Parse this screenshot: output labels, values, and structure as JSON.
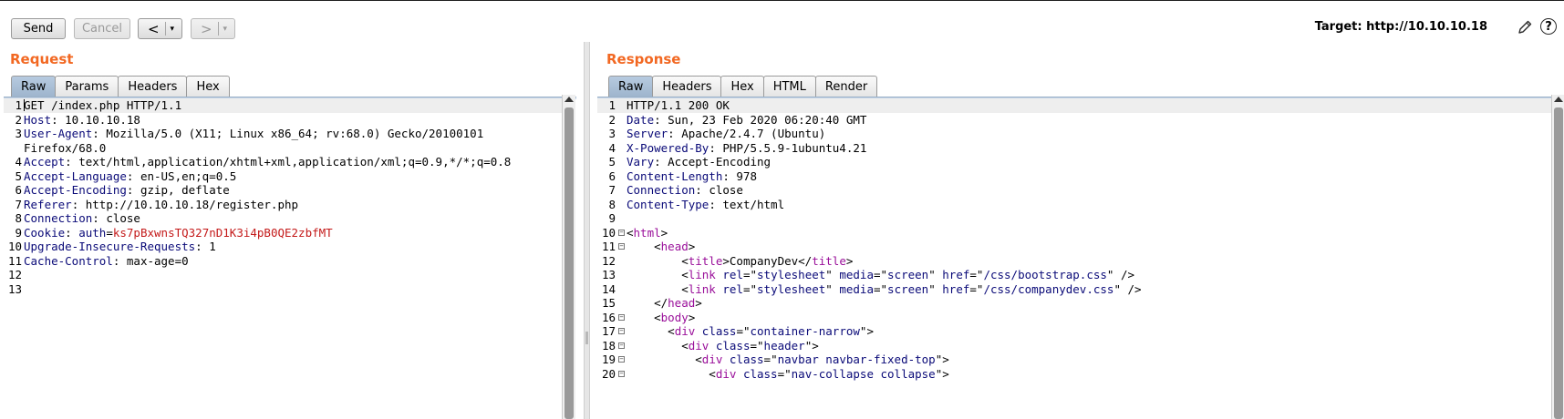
{
  "toolbar": {
    "send_label": "Send",
    "cancel_label": "Cancel",
    "back_glyph": "<",
    "forward_glyph": ">",
    "dropdown_glyph": "▾",
    "target_text": "Target: http://10.10.10.18",
    "help_glyph": "?",
    "icons": [
      "back-icon",
      "forward-icon",
      "pencil-icon",
      "help-icon"
    ]
  },
  "request": {
    "title": "Request",
    "tabs": [
      "Raw",
      "Params",
      "Headers",
      "Hex"
    ],
    "active_tab": "Raw",
    "lines": [
      {
        "n": "1",
        "parts": [
          [
            "",
            "GET /index.php HTTP/1.1"
          ]
        ]
      },
      {
        "n": "2",
        "parts": [
          [
            "hk",
            "Host"
          ],
          [
            "",
            ": 10.10.10.18"
          ]
        ]
      },
      {
        "n": "3",
        "parts": [
          [
            "hk",
            "User-Agent"
          ],
          [
            "",
            ": Mozilla/5.0 (X11; Linux x86_64; rv:68.0) Gecko/20100101"
          ]
        ]
      },
      {
        "n": "",
        "parts": [
          [
            "",
            "Firefox/68.0"
          ]
        ]
      },
      {
        "n": "4",
        "parts": [
          [
            "hk",
            "Accept"
          ],
          [
            "",
            ": text/html,application/xhtml+xml,application/xml;q=0.9,*/*;q=0.8"
          ]
        ]
      },
      {
        "n": "5",
        "parts": [
          [
            "hk",
            "Accept-Language"
          ],
          [
            "",
            ": en-US,en;q=0.5"
          ]
        ]
      },
      {
        "n": "6",
        "parts": [
          [
            "hk",
            "Accept-Encoding"
          ],
          [
            "",
            ": gzip, deflate"
          ]
        ]
      },
      {
        "n": "7",
        "parts": [
          [
            "hk",
            "Referer"
          ],
          [
            "",
            ": http://10.10.10.18/register.php"
          ]
        ]
      },
      {
        "n": "8",
        "parts": [
          [
            "hk",
            "Connection"
          ],
          [
            "",
            ": close"
          ]
        ]
      },
      {
        "n": "9",
        "parts": [
          [
            "hk",
            "Cookie"
          ],
          [
            "",
            ": "
          ],
          [
            "ck",
            "auth"
          ],
          [
            "",
            "="
          ],
          [
            "cv",
            "ks7pBxwnsTQ327nD1K3i4pB0QE2zbfMT"
          ]
        ]
      },
      {
        "n": "10",
        "parts": [
          [
            "hk",
            "Upgrade-Insecure-Requests"
          ],
          [
            "",
            ": 1"
          ]
        ]
      },
      {
        "n": "11",
        "parts": [
          [
            "hk",
            "Cache-Control"
          ],
          [
            "",
            ": max-age=0"
          ]
        ]
      },
      {
        "n": "12",
        "parts": []
      },
      {
        "n": "13",
        "parts": []
      }
    ]
  },
  "response": {
    "title": "Response",
    "tabs": [
      "Raw",
      "Headers",
      "Hex",
      "HTML",
      "Render"
    ],
    "active_tab": "Raw",
    "lines": [
      {
        "n": "1",
        "fold": false,
        "parts": [
          [
            "",
            "HTTP/1.1 200 OK"
          ]
        ]
      },
      {
        "n": "2",
        "fold": false,
        "parts": [
          [
            "hk",
            "Date"
          ],
          [
            "",
            ": Sun, 23 Feb 2020 06:20:40 GMT"
          ]
        ]
      },
      {
        "n": "3",
        "fold": false,
        "parts": [
          [
            "hk",
            "Server"
          ],
          [
            "",
            ": Apache/2.4.7 (Ubuntu)"
          ]
        ]
      },
      {
        "n": "4",
        "fold": false,
        "parts": [
          [
            "hk",
            "X-Powered-By"
          ],
          [
            "",
            ": PHP/5.5.9-1ubuntu4.21"
          ]
        ]
      },
      {
        "n": "5",
        "fold": false,
        "parts": [
          [
            "hk",
            "Vary"
          ],
          [
            "",
            ": Accept-Encoding"
          ]
        ]
      },
      {
        "n": "6",
        "fold": false,
        "parts": [
          [
            "hk",
            "Content-Length"
          ],
          [
            "",
            ": 978"
          ]
        ]
      },
      {
        "n": "7",
        "fold": false,
        "parts": [
          [
            "hk",
            "Connection"
          ],
          [
            "",
            ": close"
          ]
        ]
      },
      {
        "n": "8",
        "fold": false,
        "parts": [
          [
            "hk",
            "Content-Type"
          ],
          [
            "",
            ": text/html"
          ]
        ]
      },
      {
        "n": "9",
        "fold": false,
        "parts": []
      },
      {
        "n": "10",
        "fold": true,
        "parts": [
          [
            "",
            "<"
          ],
          [
            "tg",
            "html"
          ],
          [
            "",
            ">"
          ]
        ]
      },
      {
        "n": "11",
        "fold": true,
        "parts": [
          [
            "",
            "    <"
          ],
          [
            "tg",
            "head"
          ],
          [
            "",
            ">"
          ]
        ]
      },
      {
        "n": "12",
        "fold": false,
        "parts": [
          [
            "",
            "        <"
          ],
          [
            "tg",
            "title"
          ],
          [
            "",
            ">CompanyDev</"
          ],
          [
            "tg",
            "title"
          ],
          [
            "",
            ">"
          ]
        ]
      },
      {
        "n": "13",
        "fold": false,
        "parts": [
          [
            "",
            "        <"
          ],
          [
            "tg",
            "link"
          ],
          [
            "",
            " "
          ],
          [
            "at",
            "rel"
          ],
          [
            "",
            "=\""
          ],
          [
            "av",
            "stylesheet"
          ],
          [
            "",
            "\" "
          ],
          [
            "at",
            "media"
          ],
          [
            "",
            "=\""
          ],
          [
            "av",
            "screen"
          ],
          [
            "",
            "\" "
          ],
          [
            "at",
            "href"
          ],
          [
            "",
            "=\""
          ],
          [
            "av",
            "/css/bootstrap.css"
          ],
          [
            "",
            "\" />"
          ]
        ]
      },
      {
        "n": "14",
        "fold": false,
        "parts": [
          [
            "",
            "        <"
          ],
          [
            "tg",
            "link"
          ],
          [
            "",
            " "
          ],
          [
            "at",
            "rel"
          ],
          [
            "",
            "=\""
          ],
          [
            "av",
            "stylesheet"
          ],
          [
            "",
            "\" "
          ],
          [
            "at",
            "media"
          ],
          [
            "",
            "=\""
          ],
          [
            "av",
            "screen"
          ],
          [
            "",
            "\" "
          ],
          [
            "at",
            "href"
          ],
          [
            "",
            "=\""
          ],
          [
            "av",
            "/css/companydev.css"
          ],
          [
            "",
            "\" />"
          ]
        ]
      },
      {
        "n": "15",
        "fold": false,
        "parts": [
          [
            "",
            "    </"
          ],
          [
            "tg",
            "head"
          ],
          [
            "",
            ">"
          ]
        ]
      },
      {
        "n": "16",
        "fold": true,
        "parts": [
          [
            "",
            "    <"
          ],
          [
            "tg",
            "body"
          ],
          [
            "",
            ">"
          ]
        ]
      },
      {
        "n": "17",
        "fold": true,
        "parts": [
          [
            "",
            "      <"
          ],
          [
            "tg",
            "div"
          ],
          [
            "",
            " "
          ],
          [
            "at",
            "class"
          ],
          [
            "",
            "=\""
          ],
          [
            "av",
            "container-narrow"
          ],
          [
            "",
            "\">"
          ]
        ]
      },
      {
        "n": "18",
        "fold": true,
        "parts": [
          [
            "",
            "        <"
          ],
          [
            "tg",
            "div"
          ],
          [
            "",
            " "
          ],
          [
            "at",
            "class"
          ],
          [
            "",
            "=\""
          ],
          [
            "av",
            "header"
          ],
          [
            "",
            "\">"
          ]
        ]
      },
      {
        "n": "19",
        "fold": true,
        "parts": [
          [
            "",
            "          <"
          ],
          [
            "tg",
            "div"
          ],
          [
            "",
            " "
          ],
          [
            "at",
            "class"
          ],
          [
            "",
            "=\""
          ],
          [
            "av",
            "navbar navbar-fixed-top"
          ],
          [
            "",
            "\">"
          ]
        ]
      },
      {
        "n": "20",
        "fold": true,
        "parts": [
          [
            "",
            "            <"
          ],
          [
            "tg",
            "div"
          ],
          [
            "",
            " "
          ],
          [
            "at",
            "class"
          ],
          [
            "",
            "=\""
          ],
          [
            "av",
            "nav-collapse collapse"
          ],
          [
            "",
            "\">"
          ]
        ]
      }
    ]
  }
}
